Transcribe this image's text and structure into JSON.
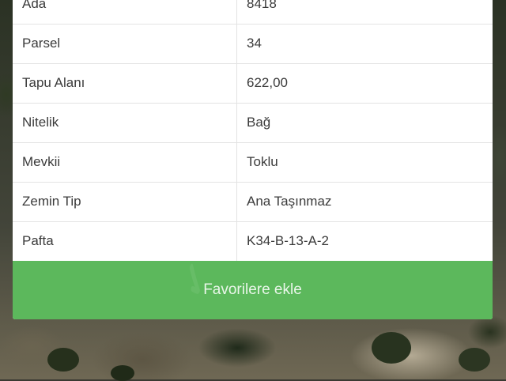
{
  "table": {
    "rows": [
      {
        "label": "Ada",
        "value": "8418"
      },
      {
        "label": "Parsel",
        "value": "34"
      },
      {
        "label": "Tapu Alanı",
        "value": "622,00"
      },
      {
        "label": "Nitelik",
        "value": "Bağ"
      },
      {
        "label": "Mevkii",
        "value": "Toklu"
      },
      {
        "label": "Zemin Tip",
        "value": "Ana Taşınmaz"
      },
      {
        "label": "Pafta",
        "value": "K34-B-13-A-2"
      }
    ]
  },
  "actions": {
    "favorite_label": "Favorilere ekle"
  },
  "colors": {
    "button_bg": "#5cb85c",
    "panel_bg": "#ffffff",
    "text": "#3b3b3b"
  }
}
